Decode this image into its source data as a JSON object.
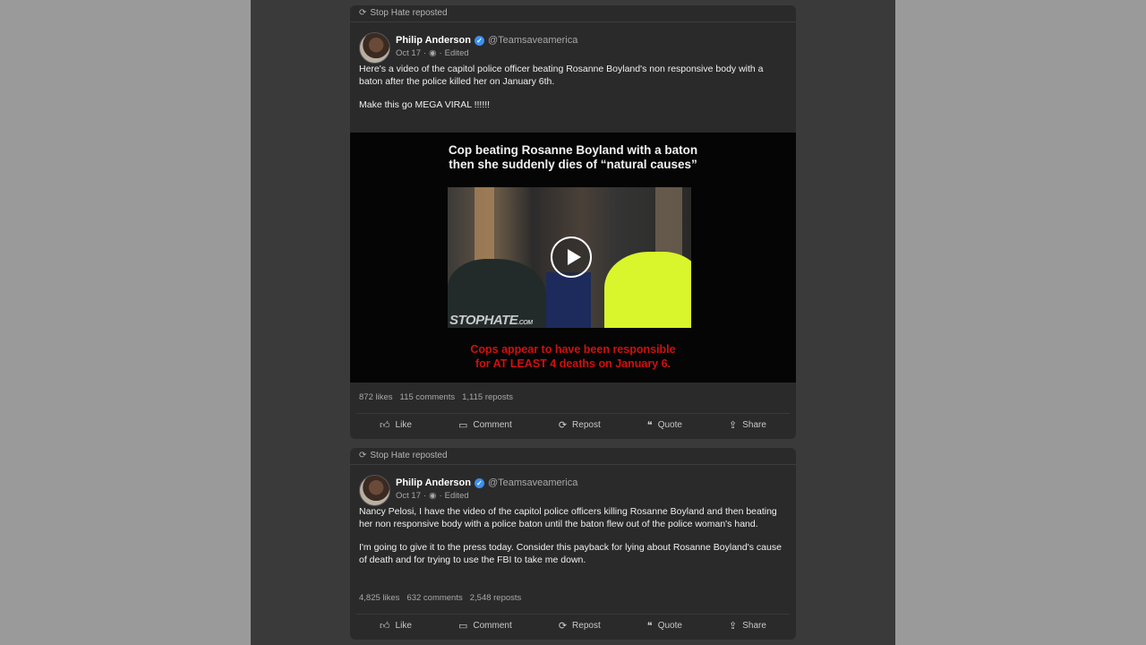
{
  "posts": [
    {
      "repost_label": "Stop Hate reposted",
      "author_name": "Philip Anderson",
      "handle": "@Teamsaveamerica",
      "date": "Oct 17",
      "edited": "Edited",
      "paragraphs": [
        "Here's a video of the capitol police officer beating Rosanne Boyland's non responsive body with a baton after the police killed her on January 6th.",
        "Make this go MEGA VIRAL !!!!!!"
      ],
      "video": {
        "title_line1": "Cop beating Rosanne Boyland with a baton",
        "title_line2": "then she suddenly dies of “natural causes”",
        "watermark": "STOPHATE",
        "watermark_suffix": ".COM",
        "caption_line1": "Cops appear to have been responsible",
        "caption_line2": "for AT LEAST 4 deaths on January 6."
      },
      "stats": {
        "likes": "872 likes",
        "comments": "115 comments",
        "reposts": "1,115 reposts"
      }
    },
    {
      "repost_label": "Stop Hate reposted",
      "author_name": "Philip Anderson",
      "handle": "@Teamsaveamerica",
      "date": "Oct 17",
      "edited": "Edited",
      "paragraphs": [
        "Nancy Pelosi, I have the video of the capitol police officers killing Rosanne Boyland and then beating her non responsive body with a police baton until the baton flew out of the police woman's hand.",
        "I'm going to give it to the press today. Consider this payback for lying about Rosanne Boyland's cause of death and for trying to use the FBI to take me down."
      ],
      "stats": {
        "likes": "4,825 likes",
        "comments": "632 comments",
        "reposts": "2,548 reposts"
      }
    }
  ],
  "actions": {
    "like": "Like",
    "comment": "Comment",
    "repost": "Repost",
    "quote": "Quote",
    "share": "Share"
  },
  "icons": {
    "repost": "repost-icon",
    "verified": "verified-badge-icon",
    "globe": "audience-icon",
    "like": "thumbs-up-icon",
    "comment": "comment-icon",
    "quote": "quote-icon",
    "share": "share-icon",
    "play": "play-icon"
  },
  "colors": {
    "verified": "#3b8ff0",
    "caption_red": "#d01010",
    "card_bg": "#2a2a2a"
  }
}
